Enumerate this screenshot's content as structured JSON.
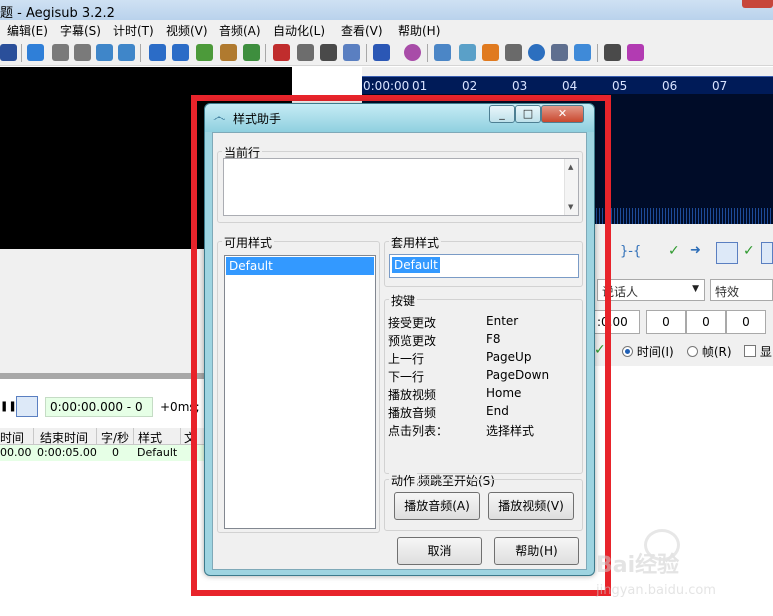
{
  "app": {
    "title": "题 - Aegisub 3.2.2"
  },
  "menu": [
    "编辑(E)",
    "字幕(S)",
    "计时(T)",
    "视频(V)",
    "音频(A)",
    "自动化(L)",
    "查看(V)",
    "帮助(H)"
  ],
  "audio": {
    "timeline": [
      "0:00:00",
      "01",
      "02",
      "03",
      "04",
      "05",
      "06",
      "07"
    ]
  },
  "right_panel": {
    "actor_placeholder": "说话人",
    "effect_placeholder": "特效",
    "time_partial": ":0.00",
    "margins": [
      "0",
      "0",
      "0"
    ],
    "radio_time": "时间(I)",
    "radio_frame": "帧(R)",
    "check_show": "显"
  },
  "video_controls": {
    "time": "0:00:00.000 - 0",
    "offset": "+0ms;"
  },
  "grid": {
    "headers": [
      "时间",
      "结束时间",
      "字/秒",
      "样式",
      "文本"
    ],
    "row": [
      "00.00",
      "0:00:05.00",
      "0",
      "Default"
    ]
  },
  "dialog": {
    "title": "样式助手",
    "current_line_label": "当前行",
    "available_styles_label": "可用样式",
    "styles": [
      "Default"
    ],
    "apply_style_label": "套用样式",
    "apply_style_value": "Default",
    "keys_label": "按键",
    "keys": [
      {
        "action": "接受更改",
        "key": "Enter"
      },
      {
        "action": "预览更改",
        "key": "F8"
      },
      {
        "action": "上一行",
        "key": "PageUp"
      },
      {
        "action": "下一行",
        "key": "PageDown"
      },
      {
        "action": "播放视频",
        "key": "Home"
      },
      {
        "action": "播放音频",
        "key": "End"
      },
      {
        "action": "点击列表：",
        "key": "选择样式"
      }
    ],
    "jump_checkbox_label": "视频跳至开始(S)",
    "jump_checked": true,
    "actions_label": "动作",
    "play_audio_label": "播放音频(A)",
    "play_video_label": "播放视频(V)",
    "cancel_label": "取消",
    "help_label": "帮助(H)"
  },
  "watermark": {
    "text": "Bai经验",
    "url": "jingyan.baidu.com"
  },
  "colors": {
    "selection": "#3399ff",
    "dialog_frame": "#9ed4e1",
    "highlight_frame": "#e8242b",
    "time_field": "#e6ffe6"
  }
}
